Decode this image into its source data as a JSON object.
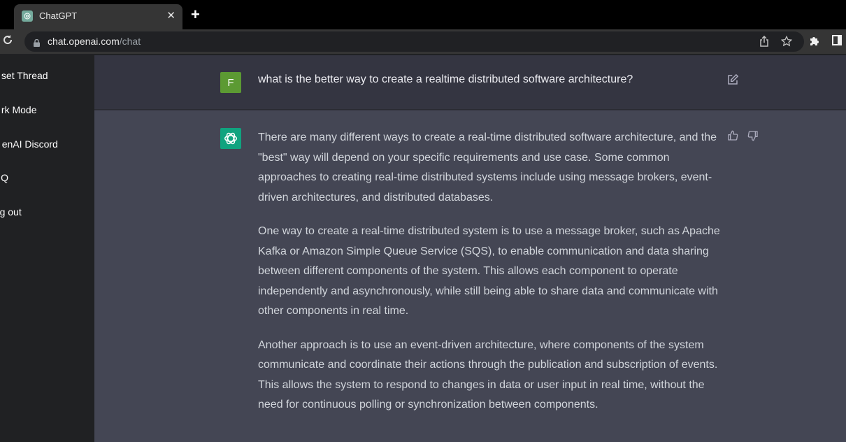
{
  "browser": {
    "tab_title": "ChatGPT",
    "tab_close": "✕",
    "new_tab": "+",
    "url_host": "chat.openai.com",
    "url_path": "/chat",
    "icons": [
      "reload-icon",
      "lock-icon",
      "share-icon",
      "bookmark-star-icon",
      "extensions-icon",
      "side-panel-icon"
    ]
  },
  "sidebar": {
    "items": [
      {
        "label": "Reset Thread",
        "visible_label": "set Thread"
      },
      {
        "label": "Dark Mode",
        "visible_label": "rk Mode"
      },
      {
        "label": "OpenAI Discord",
        "visible_label": "enAI Discord"
      },
      {
        "label": "FAQ",
        "visible_label": "Q"
      },
      {
        "label": "Log out",
        "visible_label": "g out"
      }
    ]
  },
  "conversation": {
    "user_avatar_letter": "F",
    "user_avatar_color": "#5c9a33",
    "bot_avatar_color": "#10a37f",
    "user_message": "what is the better way to create a realtime distributed software architecture?",
    "bot_paragraphs": [
      "There are many different ways to create a real-time distributed software architecture, and the \"best\" way will depend on your specific requirements and use case. Some common approaches to creating real-time distributed systems include using message brokers, event-driven architectures, and distributed databases.",
      "One way to create a real-time distributed system is to use a message broker, such as Apache Kafka or Amazon Simple Queue Service (SQS), to enable communication and data sharing between different components of the system. This allows each component to operate independently and asynchronously, while still being able to share data and communicate with other components in real time.",
      "Another approach is to use an event-driven architecture, where components of the system communicate and coordinate their actions through the publication and subscription of events. This allows the system to respond to changes in data or user input in real time, without the need for continuous polling or synchronization between components."
    ]
  },
  "colors": {
    "sidebar_bg": "#202123",
    "user_row_bg": "#343541",
    "bot_row_bg": "#444654",
    "text_user": "#ececf1",
    "text_bot": "#d1d5db"
  }
}
